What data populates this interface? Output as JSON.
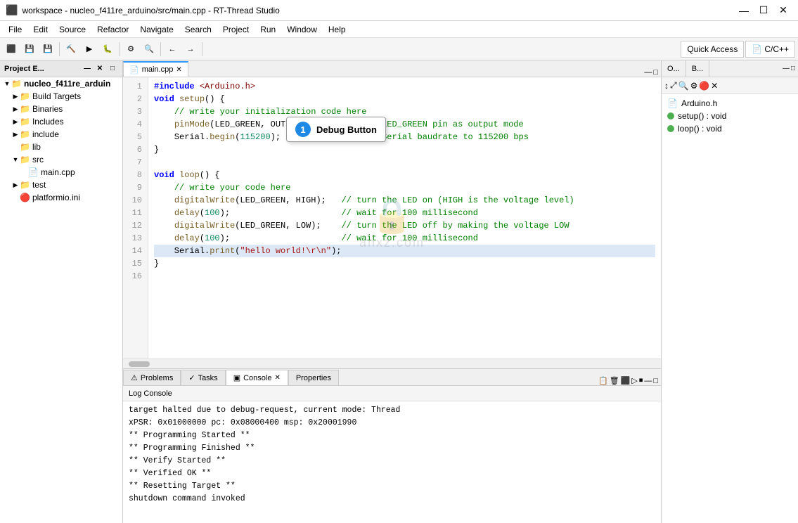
{
  "titleBar": {
    "icon": "⬛",
    "title": "workspace - nucleo_f411re_arduino/src/main.cpp - RT-Thread Studio",
    "minimizeLabel": "—",
    "maximizeLabel": "☐",
    "closeLabel": "✕"
  },
  "menuBar": {
    "items": [
      "File",
      "Edit",
      "Source",
      "Refactor",
      "Navigate",
      "Search",
      "Project",
      "Run",
      "Window",
      "Help"
    ]
  },
  "toolbar": {
    "quickAccessLabel": "Quick Access",
    "cppLabel": "C/C++"
  },
  "leftPanel": {
    "title": "Project E...",
    "tree": [
      {
        "label": "nucleo_f411re_arduin",
        "indent": 0,
        "arrow": "▼",
        "icon": "📁",
        "bold": true
      },
      {
        "label": "Build Targets",
        "indent": 1,
        "arrow": "▶",
        "icon": "📁"
      },
      {
        "label": "Binaries",
        "indent": 1,
        "arrow": "▶",
        "icon": "📁"
      },
      {
        "label": "Includes",
        "indent": 1,
        "arrow": "▶",
        "icon": "📁"
      },
      {
        "label": "include",
        "indent": 1,
        "arrow": "▶",
        "icon": "📁"
      },
      {
        "label": "lib",
        "indent": 1,
        "arrow": "",
        "icon": "📁"
      },
      {
        "label": "src",
        "indent": 1,
        "arrow": "▼",
        "icon": "📁"
      },
      {
        "label": "main.cpp",
        "indent": 2,
        "arrow": "",
        "icon": "📄"
      },
      {
        "label": "test",
        "indent": 1,
        "arrow": "▶",
        "icon": "📁"
      },
      {
        "label": "platformio.ini",
        "indent": 1,
        "arrow": "",
        "icon": "🔴"
      }
    ]
  },
  "editorTab": {
    "label": "main.cpp",
    "active": true
  },
  "codeLines": [
    {
      "num": 1,
      "content": "#include <Arduino.h>"
    },
    {
      "num": 2,
      "content": "void setup() {"
    },
    {
      "num": 3,
      "content": "    // write your initialization code here"
    },
    {
      "num": 4,
      "content": "    pinMode(LED_GREEN, OUTPUT);       // set LED_GREEN pin as output mode"
    },
    {
      "num": 5,
      "content": "    Serial.begin(115200);             // set Serial baudrate to 115200 bps"
    },
    {
      "num": 6,
      "content": "}"
    },
    {
      "num": 7,
      "content": ""
    },
    {
      "num": 8,
      "content": "void loop() {"
    },
    {
      "num": 9,
      "content": "    // write your code here"
    },
    {
      "num": 10,
      "content": "    digitalWrite(LED_GREEN, HIGH);   // turn the LED on (HIGH is the voltage level)"
    },
    {
      "num": 11,
      "content": "    delay(100);                      // wait for 100 millisecond"
    },
    {
      "num": 12,
      "content": "    digitalWrite(LED_GREEN, LOW);    // turn the LED off by making the voltage LOW"
    },
    {
      "num": 13,
      "content": "    delay(100);                      // wait for 100 millisecond"
    },
    {
      "num": 14,
      "content": "    Serial.print(\"hello world!\\r\\n\");"
    },
    {
      "num": 15,
      "content": "}"
    },
    {
      "num": 16,
      "content": ""
    }
  ],
  "rightPanel": {
    "tabs": [
      {
        "label": "O...",
        "active": false
      },
      {
        "label": "B...",
        "active": false
      }
    ],
    "outlineItems": [
      {
        "label": "Arduino.h",
        "type": "file"
      },
      {
        "label": "setup() : void",
        "type": "func",
        "dot": "green"
      },
      {
        "label": "loop() : void",
        "type": "func",
        "dot": "green"
      }
    ]
  },
  "bottomPanel": {
    "tabs": [
      {
        "label": "Problems",
        "icon": "⚠"
      },
      {
        "label": "Tasks",
        "icon": "✓"
      },
      {
        "label": "Console",
        "active": true,
        "icon": "▣"
      },
      {
        "label": "Properties",
        "icon": ""
      }
    ],
    "consoleHeader": "Log Console",
    "consoleLines": [
      "target halted due to debug-request, current mode: Thread",
      "xPSR: 0x01000000 pc: 0x08000400 msp: 0x20001990",
      "** Programming Started **",
      "** Programming Finished **",
      "** Verify Started **",
      "** Verified OK **",
      "** Resetting Target **",
      "shutdown command invoked"
    ]
  },
  "tooltip": {
    "circleLabel": "1",
    "label": "Debug Button"
  },
  "watermark": {
    "text": "anxz.com"
  }
}
